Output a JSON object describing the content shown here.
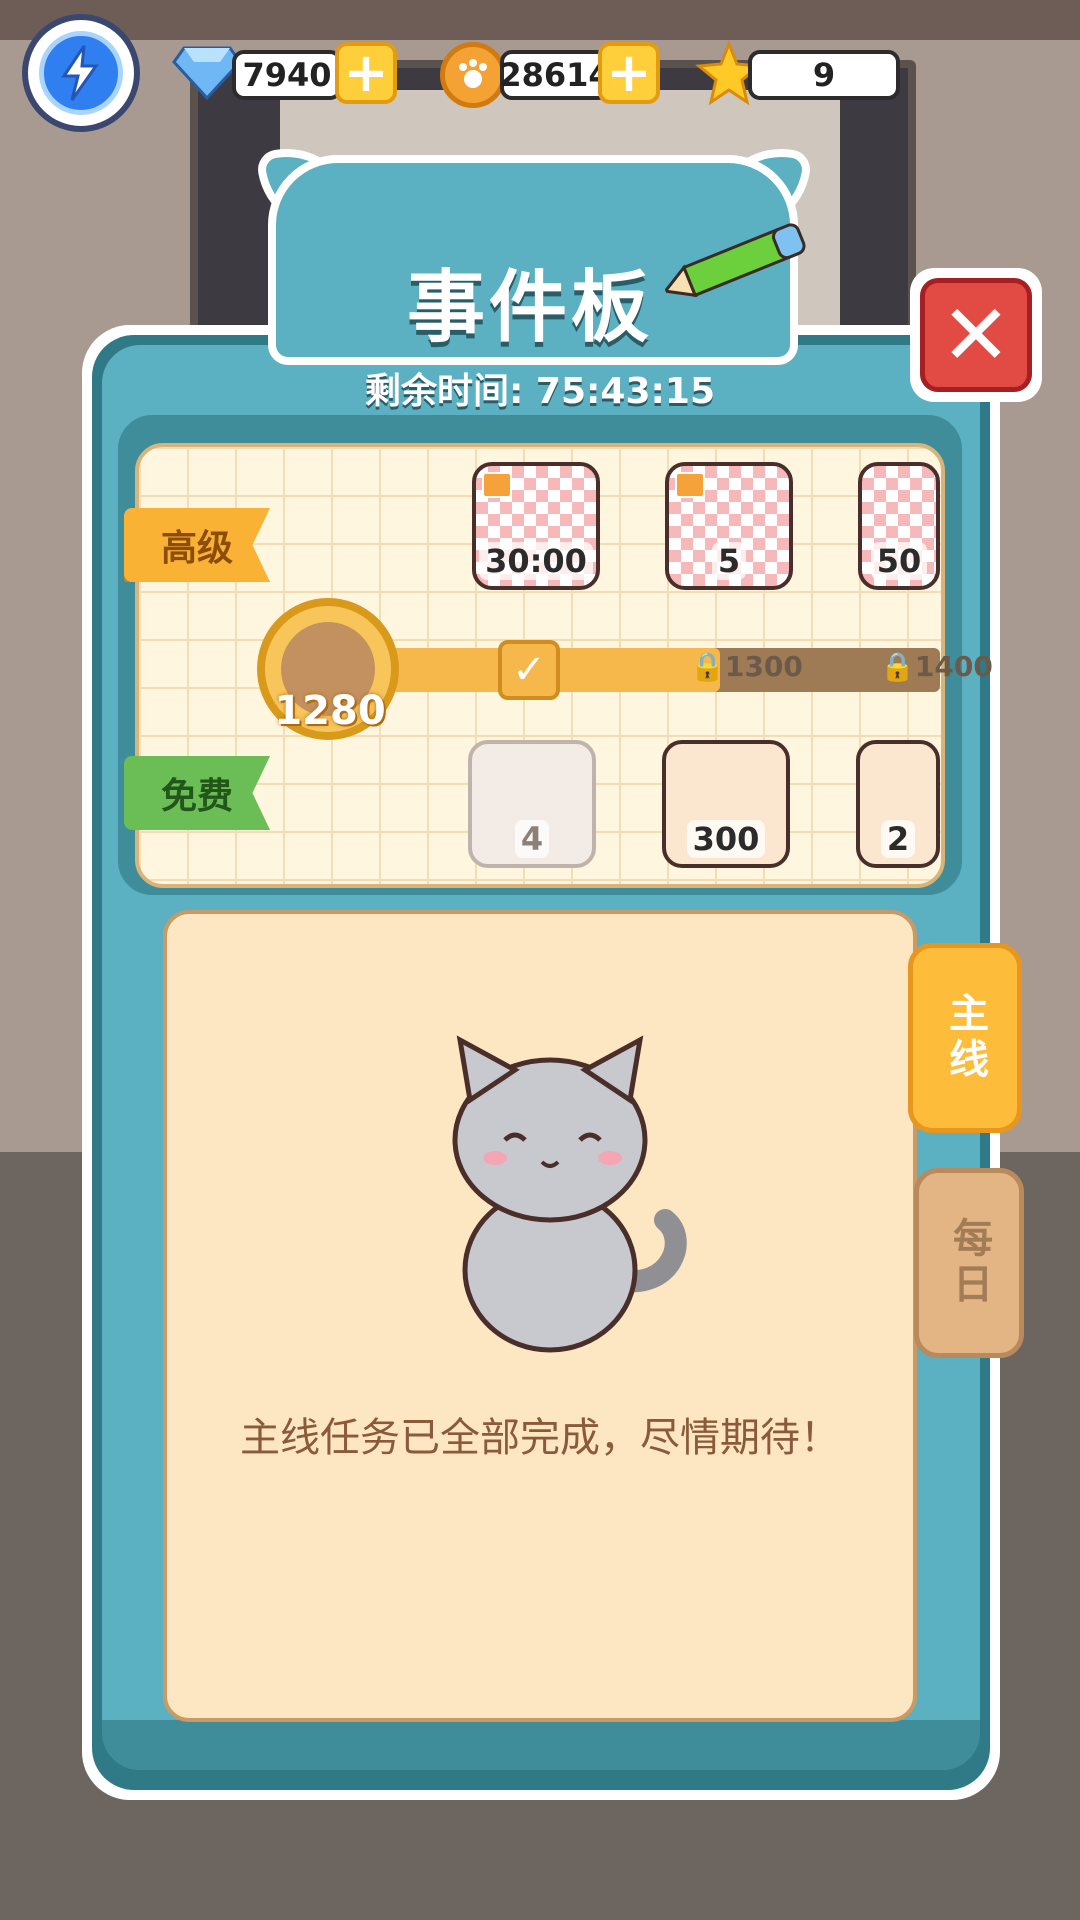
{
  "resources": {
    "gems": "7940",
    "coins": "28614",
    "stars": "9",
    "add_label": "+"
  },
  "panel": {
    "title": "事件板",
    "timer": "剩余时间: 75:43:15",
    "close_label": "✕"
  },
  "pass": {
    "premium_label": "高级",
    "free_label": "免费",
    "current_points": "1280",
    "milestones": [
      "1300",
      "1400"
    ],
    "premium_rewards": [
      {
        "label": "30:00",
        "item": "yarn-ball-icon"
      },
      {
        "label": "5",
        "item": "cat-paw-glove-icon"
      },
      {
        "label": "50",
        "item": "gem-icon"
      }
    ],
    "free_rewards": [
      {
        "label": "4",
        "item": "cat-food-bag-icon",
        "claimed": true
      },
      {
        "label": "300",
        "item": "coin-icon"
      },
      {
        "label": "2",
        "item": "cat-paw-glove-icon"
      }
    ],
    "check_mark": "✓"
  },
  "task": {
    "message": "主线任务已全部完成，尽情期待！"
  },
  "tabs": {
    "main": "主线",
    "daily": "每日"
  },
  "colors": {
    "panel_teal": "#5bb0c2",
    "panel_dark": "#2f7a86",
    "accent_yellow": "#fdbd3a",
    "close_red": "#e24a44",
    "free_green": "#6bbd55"
  }
}
